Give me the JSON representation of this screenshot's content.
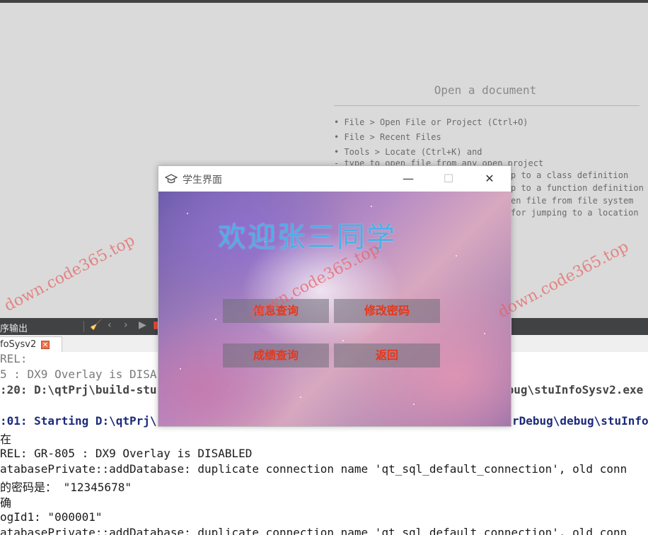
{
  "welcome": {
    "title": "Open a document",
    "hints": [
      "• File > Open File or Project (Ctrl+O)",
      "• File > Recent Files",
      "• Tools > Locate (Ctrl+K) and",
      "  - type to open file from any open project",
      "p to a class definition",
      "p to a function definition",
      "en file from file system",
      "for jumping to a location"
    ]
  },
  "output_panel": {
    "title": "序输出",
    "tab_label": "foSysv2",
    "lines": [
      "REL:",
      "5 : DX9 Overlay is DISA",
      ":20: D:\\qtPrj\\build-stu",
      "ebug\\stuInfoSysv2.exe",
      "",
      ":01: Starting D:\\qtPrj\\",
      "rDebug\\debug\\stuInfo",
      "在",
      "REL: GR-805 : DX9 Overlay is DISABLED",
      "atabasePrivate::addDatabase: duplicate connection name 'qt_sql_default_connection', old conn",
      "的密码是：  \"12345678\"",
      "确",
      "ogId1: \"000001\"",
      "atabasePrivate::addDatabase: duplicate connection name 'qt_sql_default_connection', old conn"
    ]
  },
  "dialog": {
    "title": "学生界面",
    "welcome_text": "欢迎张三同学",
    "buttons": {
      "info_query": "信息查询",
      "change_password": "修改密码",
      "grade_query": "成绩查询",
      "back": "返回"
    }
  },
  "watermark": "down.code365.top"
}
